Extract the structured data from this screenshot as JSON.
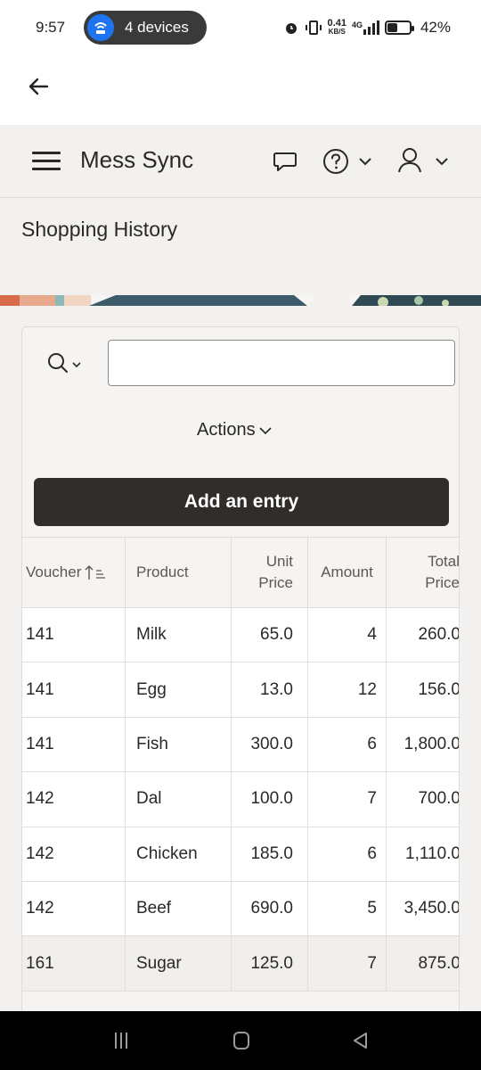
{
  "status_bar": {
    "time": "9:57",
    "hotspot_label": "4 devices",
    "net_speed_value": "0.41",
    "net_speed_unit": "KB/S",
    "network_type": "4G",
    "battery_percent": "42%",
    "battery_level": 0.42
  },
  "app": {
    "title": "Mess Sync"
  },
  "page": {
    "title": "Shopping History"
  },
  "search": {
    "value": "",
    "placeholder": ""
  },
  "toolbar": {
    "actions_label": "Actions",
    "add_entry_label": "Add an entry"
  },
  "table": {
    "columns": [
      {
        "label": "Voucher"
      },
      {
        "label": "Product"
      },
      {
        "label_line1": "Unit",
        "label_line2": "Price"
      },
      {
        "label": "Amount"
      },
      {
        "label_line1": "Total",
        "label_line2": "Price"
      }
    ],
    "rows": [
      {
        "voucher": "141",
        "product": "Milk",
        "unit_price": "65.0",
        "amount": "4",
        "total": "260.0"
      },
      {
        "voucher": "141",
        "product": "Egg",
        "unit_price": "13.0",
        "amount": "12",
        "total": "156.0"
      },
      {
        "voucher": "141",
        "product": "Fish",
        "unit_price": "300.0",
        "amount": "6",
        "total": "1,800.0"
      },
      {
        "voucher": "142",
        "product": "Dal",
        "unit_price": "100.0",
        "amount": "7",
        "total": "700.0"
      },
      {
        "voucher": "142",
        "product": "Chicken",
        "unit_price": "185.0",
        "amount": "6",
        "total": "1,110.0"
      },
      {
        "voucher": "142",
        "product": "Beef",
        "unit_price": "690.0",
        "amount": "5",
        "total": "3,450.0"
      },
      {
        "voucher": "161",
        "product": "Sugar",
        "unit_price": "125.0",
        "amount": "7",
        "total": "875.0"
      }
    ]
  },
  "icons": {
    "back": "arrow-left-icon",
    "menu": "hamburger-icon",
    "chat": "chat-bubble-icon",
    "help": "question-circle-icon",
    "user": "user-icon",
    "search": "search-icon",
    "sort": "sort-ascending-icon"
  },
  "colors": {
    "primary_button": "#312d2a",
    "header_bg": "#f2f1ef",
    "hotspot_blue": "#1e74f0"
  }
}
